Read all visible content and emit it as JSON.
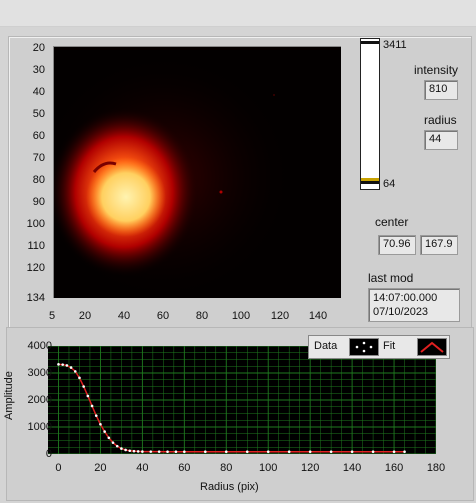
{
  "colorbar": {
    "max_label": "3411",
    "min_label": "64"
  },
  "intensity": {
    "label": "intensity",
    "value": "810"
  },
  "radius": {
    "label": "radius",
    "value": "44"
  },
  "center": {
    "label": "center",
    "x": "70.96",
    "y": "167.9"
  },
  "last_mod": {
    "label": "last mod",
    "time": "14:07:00.000",
    "date": "07/10/2023"
  },
  "image_axes": {
    "y_ticks": [
      "20",
      "30",
      "40",
      "50",
      "60",
      "70",
      "80",
      "90",
      "100",
      "110",
      "120",
      "134"
    ],
    "x_ticks": [
      "5",
      "20",
      "40",
      "60",
      "80",
      "100",
      "120",
      "140"
    ]
  },
  "chart_data": {
    "type": "scatter",
    "xlabel": "Radius (pix)",
    "ylabel": "Amplitude",
    "xlim": [
      -5,
      180
    ],
    "ylim": [
      0,
      4000
    ],
    "x_ticks": [
      0,
      20,
      40,
      60,
      80,
      100,
      120,
      140,
      160,
      180
    ],
    "y_ticks": [
      0,
      1000,
      2000,
      3000,
      4000
    ],
    "grid": true,
    "legend_position": "top-right",
    "series": [
      {
        "name": "Data",
        "x": [
          0,
          2,
          4,
          6,
          8,
          10,
          12,
          14,
          16,
          18,
          20,
          22,
          24,
          26,
          28,
          30,
          32,
          34,
          36,
          38,
          40,
          44,
          48,
          52,
          56,
          60,
          70,
          80,
          90,
          100,
          110,
          120,
          130,
          140,
          150,
          160,
          165
        ],
        "y": [
          3320,
          3310,
          3280,
          3200,
          3060,
          2820,
          2500,
          2150,
          1780,
          1420,
          1100,
          830,
          600,
          420,
          290,
          200,
          150,
          120,
          105,
          95,
          90,
          88,
          86,
          85,
          85,
          85,
          85,
          85,
          85,
          85,
          85,
          85,
          85,
          85,
          85,
          85,
          85
        ]
      },
      {
        "name": "Fit",
        "x": [
          0,
          2,
          4,
          6,
          8,
          10,
          12,
          14,
          16,
          18,
          20,
          22,
          24,
          26,
          28,
          30,
          32,
          34,
          36,
          38,
          40,
          44,
          48,
          52,
          56,
          60,
          70,
          80,
          90,
          100,
          110,
          120,
          130,
          140,
          150,
          160,
          165
        ],
        "y": [
          3320,
          3310,
          3280,
          3200,
          3060,
          2820,
          2500,
          2150,
          1780,
          1420,
          1100,
          830,
          600,
          420,
          290,
          200,
          150,
          120,
          105,
          95,
          90,
          88,
          86,
          85,
          85,
          85,
          85,
          85,
          85,
          85,
          85,
          85,
          85,
          85,
          85,
          85,
          85
        ]
      }
    ],
    "colors": {
      "data_marker": "#ffffff",
      "fit_line": "#e02020",
      "grid": "#1f7a1f",
      "background": "#000000"
    }
  }
}
